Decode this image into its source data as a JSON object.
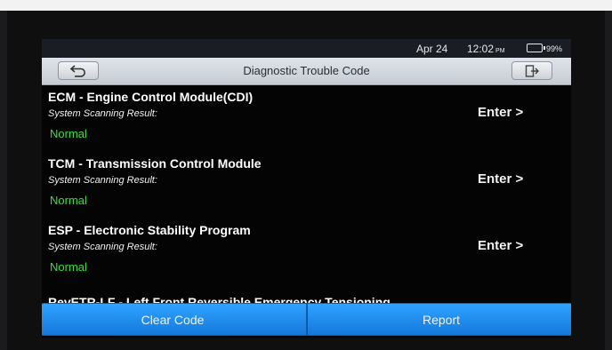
{
  "status_bar": {
    "date": "Apr 24",
    "time": "12:02",
    "ampm": "PM",
    "battery": "99%"
  },
  "header": {
    "title": "Diagnostic Trouble Code",
    "back_icon": "back-arrow-icon",
    "exit_icon": "exit-door-icon"
  },
  "systems": [
    {
      "title": "ECM - Engine Control Module(CDI)",
      "subtitle": "System Scanning Result:",
      "status": "Normal",
      "enter_label": "Enter >"
    },
    {
      "title": "TCM - Transmission Control Module",
      "subtitle": "System Scanning Result:",
      "status": "Normal",
      "enter_label": "Enter >"
    },
    {
      "title": "ESP - Electronic Stability Program",
      "subtitle": "System Scanning Result:",
      "status": "Normal",
      "enter_label": "Enter >"
    },
    {
      "title": "RevETR-LF - Left Front Reversible Emergency Tensioning"
    }
  ],
  "actions": {
    "clear_label": "Clear Code",
    "report_label": "Report"
  },
  "colors": {
    "normal_status": "#33e03a",
    "button_blue": "#1e8bef",
    "title_bar": "#d3d8de"
  }
}
